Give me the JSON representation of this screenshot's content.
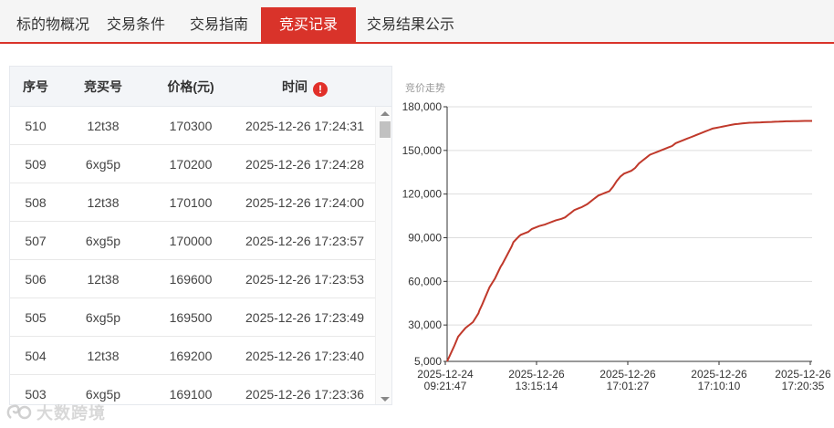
{
  "tabs": [
    {
      "label": "标的物概况",
      "active": false
    },
    {
      "label": "交易条件",
      "active": false
    },
    {
      "label": "交易指南",
      "active": false
    },
    {
      "label": "竞买记录",
      "active": true
    },
    {
      "label": "交易结果公示",
      "active": false
    }
  ],
  "table": {
    "headers": {
      "seq": "序号",
      "bidder": "竞买号",
      "price": "价格(元)",
      "time": "时间"
    },
    "warning_icon": "exclamation-icon",
    "rows": [
      {
        "seq": "510",
        "bidder": "12t38",
        "price": "170300",
        "time": "2025-12-26 17:24:31"
      },
      {
        "seq": "509",
        "bidder": "6xg5p",
        "price": "170200",
        "time": "2025-12-26 17:24:28"
      },
      {
        "seq": "508",
        "bidder": "12t38",
        "price": "170100",
        "time": "2025-12-26 17:24:00"
      },
      {
        "seq": "507",
        "bidder": "6xg5p",
        "price": "170000",
        "time": "2025-12-26 17:23:57"
      },
      {
        "seq": "506",
        "bidder": "12t38",
        "price": "169600",
        "time": "2025-12-26 17:23:53"
      },
      {
        "seq": "505",
        "bidder": "6xg5p",
        "price": "169500",
        "time": "2025-12-26 17:23:49"
      },
      {
        "seq": "504",
        "bidder": "12t38",
        "price": "169200",
        "time": "2025-12-26 17:23:40"
      },
      {
        "seq": "503",
        "bidder": "6xg5p",
        "price": "169100",
        "time": "2025-12-26 17:23:36"
      }
    ]
  },
  "watermark": "大数跨境",
  "colors": {
    "accent": "#d9332a",
    "line": "#c0392b",
    "grid": "#dddddd"
  },
  "chart_data": {
    "type": "line",
    "title": "竞价走势",
    "xlabel": "",
    "ylabel": "",
    "ylim": [
      5000,
      180000
    ],
    "yticks": [
      "5,000",
      "30,000",
      "60,000",
      "90,000",
      "120,000",
      "150,000",
      "180,000"
    ],
    "ytick_values": [
      5000,
      30000,
      60000,
      90000,
      120000,
      150000,
      180000
    ],
    "xticks": [
      {
        "date": "2025-12-24",
        "time": "09:21:47"
      },
      {
        "date": "2025-12-26",
        "time": "13:15:14"
      },
      {
        "date": "2025-12-26",
        "time": "17:01:27"
      },
      {
        "date": "2025-12-26",
        "time": "17:10:10"
      },
      {
        "date": "2025-12-26",
        "time": "17:20:35"
      }
    ],
    "grid": true,
    "series": [
      {
        "name": "",
        "x": [
          0,
          3,
          8,
          12,
          20,
          28,
          34,
          35,
          38,
          42,
          46,
          52,
          58,
          60,
          65,
          70,
          72,
          78,
          80,
          84,
          88,
          92,
          100,
          106,
          110,
          114,
          118,
          124,
          128,
          132,
          134,
          138,
          142,
          146,
          152,
          156,
          160,
          164,
          168,
          172,
          176,
          180,
          184,
          188,
          192,
          196,
          200,
          204,
          208,
          212,
          216,
          220,
          224,
          228,
          232,
          236,
          240,
          244,
          248,
          252,
          256,
          260,
          264,
          268,
          272,
          276,
          280,
          284,
          288,
          292,
          296,
          300,
          304,
          308,
          312,
          316,
          320,
          324,
          328,
          332,
          336,
          340,
          344,
          348,
          352,
          356,
          360,
          364,
          368,
          372,
          376,
          380,
          384,
          388,
          392,
          396
        ],
        "values": [
          5000,
          9000,
          16000,
          22000,
          28000,
          32000,
          38000,
          40000,
          44000,
          50000,
          56000,
          62000,
          70000,
          72000,
          78000,
          84000,
          87000,
          91000,
          92000,
          93000,
          94000,
          96000,
          98000,
          99000,
          100000,
          101000,
          102000,
          103000,
          104000,
          106000,
          107000,
          109000,
          110000,
          111000,
          113000,
          115000,
          117000,
          119000,
          120000,
          121000,
          122000,
          125000,
          129000,
          132000,
          134000,
          135000,
          136000,
          138000,
          141000,
          143000,
          145000,
          147000,
          148000,
          149000,
          150000,
          151000,
          152000,
          153000,
          155000,
          156000,
          157000,
          158000,
          159000,
          160000,
          161000,
          162000,
          163000,
          164000,
          165000,
          165500,
          166000,
          166500,
          167000,
          167500,
          168000,
          168300,
          168600,
          168800,
          169000,
          169100,
          169200,
          169300,
          169400,
          169500,
          169600,
          169700,
          169800,
          169900,
          170000,
          170050,
          170100,
          170150,
          170200,
          170250,
          170280,
          170300
        ]
      }
    ]
  }
}
